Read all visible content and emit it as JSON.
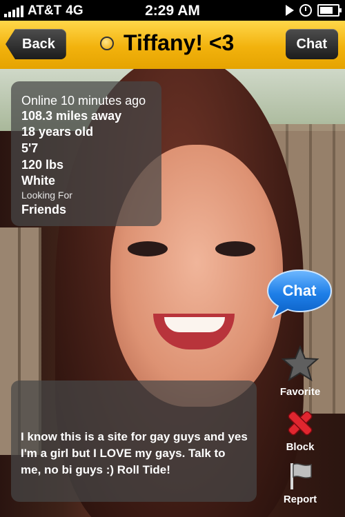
{
  "status_bar": {
    "carrier": "AT&T",
    "network": "4G",
    "time": "2:29 AM",
    "icons": [
      "signal-icon",
      "play-icon",
      "clock-icon",
      "battery-icon"
    ]
  },
  "nav": {
    "back_label": "Back",
    "title": "Tiffany! <3",
    "chat_label": "Chat",
    "status_icon": "online-dot-icon",
    "bar_color": "#f2b20d"
  },
  "profile": {
    "last_online": "Online 10 minutes ago",
    "distance": "108.3 miles away",
    "age": "18 years old",
    "height": "5'7",
    "weight": "120 lbs",
    "ethnicity": "White",
    "looking_for_label": "Looking For",
    "looking_for": "Friends",
    "bio": "I know this is a site for gay guys and yes I'm a girl but I LOVE my gays. Talk to me, no bi guys :) Roll Tide!"
  },
  "actions": {
    "chat_label": "Chat",
    "favorite_label": "Favorite",
    "block_label": "Block",
    "report_label": "Report",
    "icons": {
      "favorite": "star-icon",
      "block": "x-icon",
      "report": "flag-icon"
    }
  }
}
